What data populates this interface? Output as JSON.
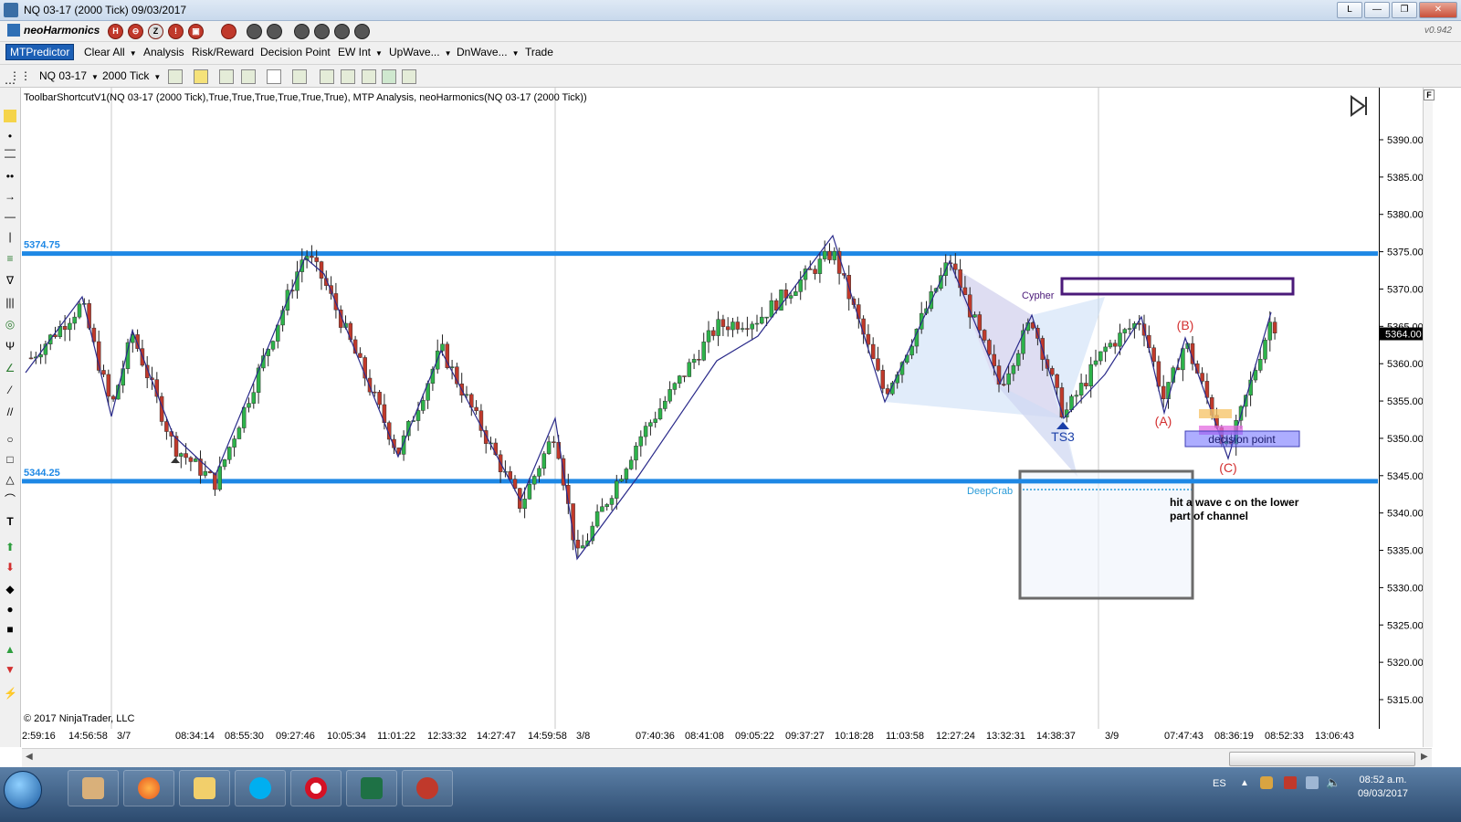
{
  "window": {
    "title": "NQ 03-17 (2000 Tick)  09/03/2017"
  },
  "nh": {
    "brand": "neoHarmonics",
    "version": "v0.942",
    "buttons": [
      "H",
      "⊖",
      "Z",
      "!",
      "▣"
    ]
  },
  "menu": {
    "items": [
      "MTPredictor",
      "Clear All",
      "Analysis",
      "Risk/Reward",
      "Decision Point",
      "EW Int",
      "UpWave...",
      "DnWave...",
      "Trade"
    ]
  },
  "toolbar": {
    "instrument": "NQ 03-17",
    "interval": "2000 Tick"
  },
  "chart": {
    "indicator_label": "ToolbarShortcutV1(NQ 03-17 (2000 Tick),True,True,True,True,True,True), MTP Analysis, neoHarmonics(NQ 03-17 (2000 Tick))",
    "copyright": "© 2017 NinjaTrader, LLC",
    "upper_level_label": "5374.75",
    "lower_level_label": "5344.25",
    "current_price": "5364.00",
    "y_ticks": [
      "5390.00",
      "5385.00",
      "5380.00",
      "5375.00",
      "5370.00",
      "5365.00",
      "5360.00",
      "5355.00",
      "5350.00",
      "5345.00",
      "5340.00",
      "5335.00",
      "5330.00",
      "5325.00",
      "5320.00",
      "5315.00"
    ],
    "x_ticks": [
      "2:59:16",
      "14:56:58",
      "3/7",
      "08:34:14",
      "08:55:30",
      "09:27:46",
      "10:05:34",
      "11:01:22",
      "12:33:32",
      "14:27:47",
      "14:59:58",
      "3/8",
      "07:40:36",
      "08:41:08",
      "09:05:22",
      "09:37:27",
      "10:18:28",
      "11:03:58",
      "12:27:24",
      "13:32:31",
      "14:38:37",
      "3/9",
      "07:47:43",
      "08:36:19",
      "08:52:33",
      "13:06:43"
    ],
    "annotations": {
      "cypher": "Cypher",
      "ts3": "TS3",
      "deepcrab": "DeepCrab",
      "a": "(A)",
      "b": "(B)",
      "c": "(C)",
      "decision_point": "decision point",
      "note": "hit a wave c on the lower part of channel"
    },
    "colors": {
      "up_candle": "#2db34a",
      "down_candle": "#c0392b",
      "channel_line": "#1e88e5",
      "swing_line": "#2a2a8a",
      "abc_label": "#d32f2f"
    }
  },
  "taskbar": {
    "lang": "ES",
    "time": "08:52 a.m.",
    "date": "09/03/2017"
  }
}
